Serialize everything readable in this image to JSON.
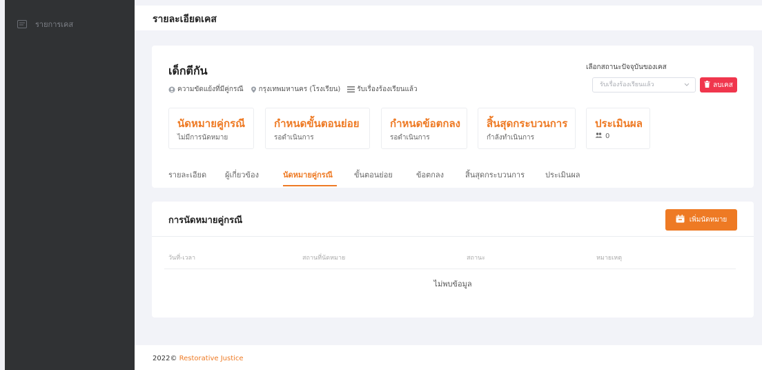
{
  "sidebar": {
    "items": [
      {
        "label": "รายการเคส",
        "icon": "list-icon"
      }
    ]
  },
  "header": {
    "title": "รายละเอียดเคส"
  },
  "case": {
    "name": "เด็กตีกัน",
    "meta": {
      "conflict": "ความขัดแย้งที่มีคู่กรณี",
      "location": "กรุงเทพมหานคร (โรงเรียน)",
      "status": "รับเรื่องร้องเรียนแล้ว"
    },
    "status_label": "เลือกสถานะปัจจุบันของเคส",
    "status_value": "รับเรื่องร้องเรียนแล้ว",
    "delete_label": "ลบเคส"
  },
  "stages": [
    {
      "title": "นัดหมายคู่กรณี",
      "subtitle": "ไม่มีการนัดหมาย"
    },
    {
      "title": "กำหนดขั้นตอนย่อย",
      "subtitle": "รอดำเนินการ"
    },
    {
      "title": "กำหนดข้อตกลง",
      "subtitle": "รอดำเนินการ"
    },
    {
      "title": "สิ้นสุดกระบวนการ",
      "subtitle": "กำลังทำเนินการ"
    },
    {
      "title": "ประเมินผล",
      "subtitle": "0"
    }
  ],
  "tabs": [
    {
      "label": "รายละเอียด"
    },
    {
      "label": "ผู้เกี่ยวข้อง"
    },
    {
      "label": "นัดหมายคู่กรณี",
      "active": true
    },
    {
      "label": "ขั้นตอนย่อย"
    },
    {
      "label": "ข้อตกลง"
    },
    {
      "label": "สิ้นสุดกระบวนการ"
    },
    {
      "label": "ประเมินผล"
    }
  ],
  "appointments": {
    "title": "การนัดหมายคู่กรณี",
    "add_label": "เพิ่มนัดหมาย",
    "columns": [
      "วันที่-เวลา",
      "สถานที่นัดหมาย",
      "สถานะ",
      "หมายเหตุ"
    ],
    "empty_text": "ไม่พบข้อมูล"
  },
  "footer": {
    "year": "2022©",
    "brand": "Restorative Justice"
  },
  "colors": {
    "accent": "#ee7a24",
    "danger": "#f0364d",
    "sidebar_bg": "#303234",
    "page_bg": "#f2f3f8"
  }
}
